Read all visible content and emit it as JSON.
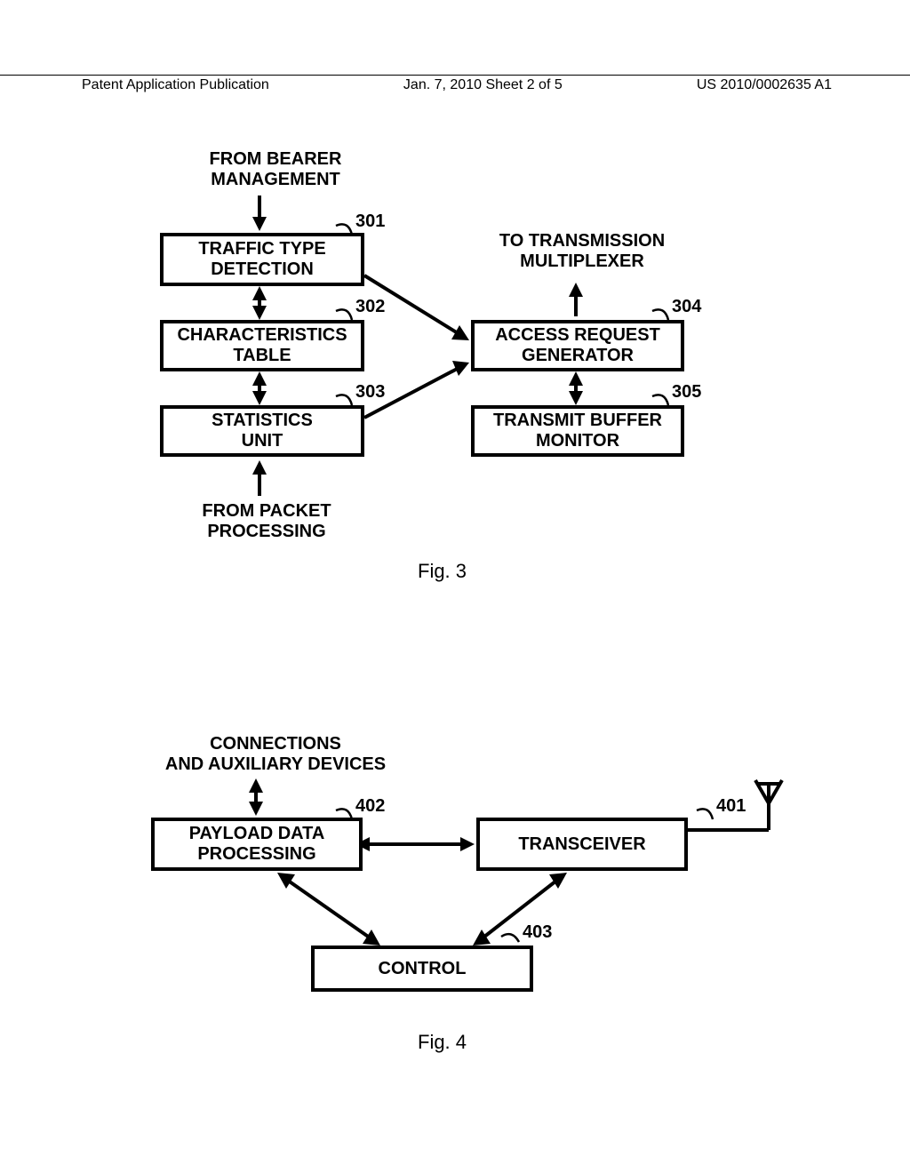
{
  "header": {
    "left": "Patent Application Publication",
    "center": "Jan. 7, 2010  Sheet 2 of 5",
    "right": "US 2010/0002635 A1"
  },
  "fig3": {
    "top_label": "FROM BEARER\nMANAGEMENT",
    "box301": "TRAFFIC TYPE\nDETECTION",
    "box302": "CHARACTERISTICS\nTABLE",
    "box303": "STATISTICS\nUNIT",
    "box304": "ACCESS REQUEST\nGENERATOR",
    "box305": "TRANSMIT BUFFER\nMONITOR",
    "right_label": "TO TRANSMISSION\nMULTIPLEXER",
    "bottom_label": "FROM PACKET\nPROCESSING",
    "ref301": "301",
    "ref302": "302",
    "ref303": "303",
    "ref304": "304",
    "ref305": "305",
    "caption": "Fig. 3"
  },
  "fig4": {
    "top_label": "CONNECTIONS\nAND AUXILIARY DEVICES",
    "box402": "PAYLOAD DATA\nPROCESSING",
    "box401": "TRANSCEIVER",
    "box403": "CONTROL",
    "ref401": "401",
    "ref402": "402",
    "ref403": "403",
    "caption": "Fig. 4"
  }
}
